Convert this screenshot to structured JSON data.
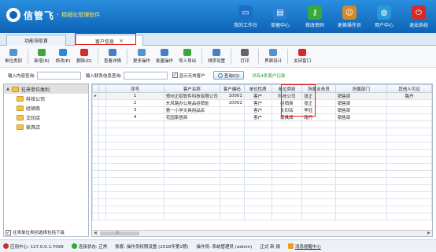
{
  "header": {
    "brand": "信管飞",
    "tagline": "精细化管理软件",
    "nav": [
      {
        "label": "我的工作台",
        "icon": "monitor-icon",
        "color": "#1d6fc5"
      },
      {
        "label": "单据中心",
        "icon": "document-icon",
        "color": "#2b7fd2"
      },
      {
        "label": "修改密码",
        "icon": "key-icon",
        "color": "#3aa83a"
      },
      {
        "label": "更换操作员",
        "icon": "user-icon",
        "color": "#d08a2a"
      },
      {
        "label": "用户中心",
        "icon": "globe-icon",
        "color": "#2a9ad6"
      },
      {
        "label": "退出系统",
        "icon": "power-icon",
        "color": "#d42a2a"
      }
    ]
  },
  "tabs": {
    "nav_tab": "功能导航首",
    "active_tab": "客户信息",
    "close_symbol": "×"
  },
  "toolbar": {
    "buttons": [
      {
        "label": "单位类别",
        "icon": "category-icon",
        "color": "#5a8fd0"
      },
      {
        "label": "新增(N)",
        "icon": "add-icon",
        "color": "#3aa83a"
      },
      {
        "label": "修改(E)",
        "icon": "edit-icon",
        "color": "#2a8ad6"
      },
      {
        "label": "删除(D)",
        "icon": "delete-icon",
        "color": "#d42a2a"
      },
      {
        "label": "查看详情",
        "icon": "view-details-icon",
        "color": "#4a7fc0"
      },
      {
        "label": "更多操作",
        "icon": "more-icon",
        "color": "#5a8fd0"
      },
      {
        "label": "批量操作",
        "icon": "batch-icon",
        "color": "#4a7fc0"
      },
      {
        "label": "导入导出",
        "icon": "import-export-icon",
        "color": "#3aa83a"
      },
      {
        "label": "排序设置",
        "icon": "sort-icon",
        "color": "#4a7fc0"
      },
      {
        "label": "打印",
        "icon": "print-icon",
        "color": "#666666"
      },
      {
        "label": "界面设计",
        "icon": "layout-icon",
        "color": "#5a8fd0"
      },
      {
        "label": "关闭窗口",
        "icon": "close-window-icon",
        "color": "#d42a2a"
      }
    ]
  },
  "search": {
    "content_label": "输入内容查询:",
    "content_value": "",
    "contact_label": "输入联系信息查询:",
    "contact_value": "",
    "show_invalid_label": "显示无效客户",
    "show_invalid_checked": "✓",
    "query_button": "查询(Q)",
    "count_text": "共有4条客户记录"
  },
  "tree": {
    "root": "往来单位类别",
    "root_expand": "▲",
    "items": [
      "科技公司",
      "经销商",
      "文印店",
      "家具店"
    ],
    "footer_label": "往来单位类别选择包括下级",
    "footer_checked": "✓"
  },
  "grid": {
    "columns": [
      "序号",
      "客户名称",
      "客户编码",
      "单位性质",
      "单位类别",
      "所属业务员",
      "所属部门",
      "其他人可见"
    ],
    "rows": [
      [
        "1",
        "郑州正招软件科技有限公司",
        "10001",
        "客户",
        "科技公司",
        "张正",
        "销售部",
        "路丹"
      ],
      [
        "2",
        "东风路办公用品经销处",
        "10002",
        "客户",
        "经销商",
        "张正",
        "销售部",
        ""
      ],
      [
        "3",
        "第一小学文具用品店",
        "",
        "客户",
        "文印店",
        "李钰",
        "销售部",
        ""
      ],
      [
        "4",
        "花园家居商",
        "",
        "客户",
        "家具店",
        "路丹",
        "销售部",
        ""
      ]
    ],
    "scroll_left": "◀",
    "scroll_mid": "III",
    "scroll_right": "▶"
  },
  "status": {
    "app_center": "应用中心: 127.0.0.1:7099",
    "connection": "连接状态: 正常",
    "version": "账套: 操作员权限设置 (2018年第1期)",
    "operator": "操作员: 系统管理员 (admin)",
    "edition": "正式 新 捐",
    "message_center": "消息提醒中心"
  }
}
